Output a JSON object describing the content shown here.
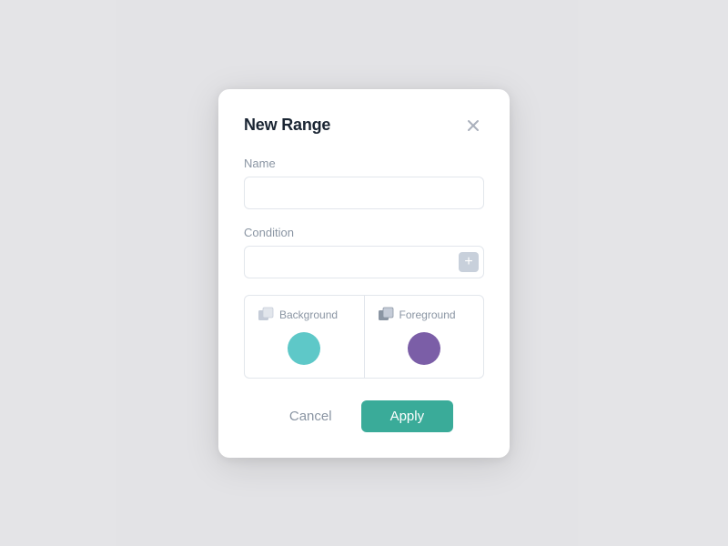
{
  "dialog": {
    "title": "New Range",
    "close_label": "×"
  },
  "name_field": {
    "label": "Name",
    "placeholder": "",
    "value": ""
  },
  "condition_field": {
    "label": "Condition",
    "placeholder": "",
    "value": "",
    "add_button_label": "+"
  },
  "background_panel": {
    "label": "Background",
    "color": "#5ec8c8"
  },
  "foreground_panel": {
    "label": "Foreground",
    "color": "#7b5ea7"
  },
  "actions": {
    "cancel_label": "Cancel",
    "apply_label": "Apply"
  }
}
